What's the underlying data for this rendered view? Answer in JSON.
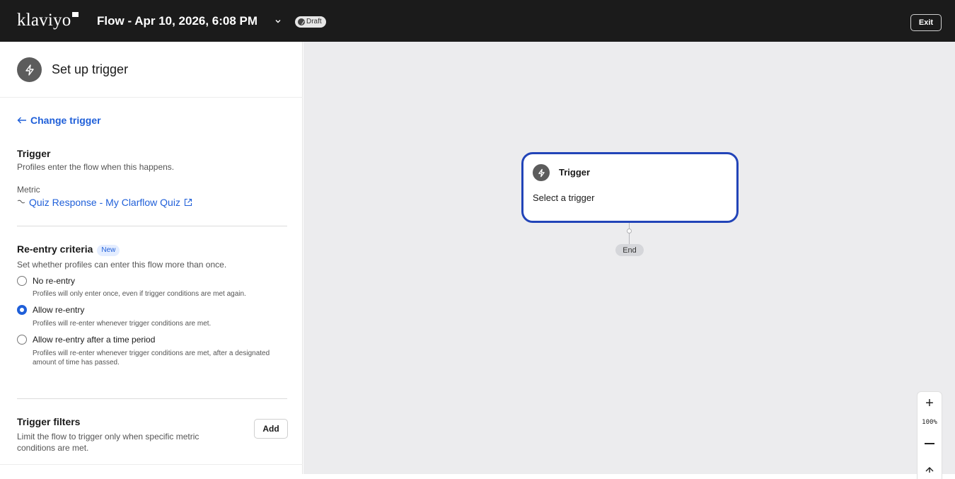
{
  "header": {
    "logo": "klaviyo",
    "flow_title": "Flow - Apr 10, 2026, 6:08 PM",
    "status_badge": "Draft",
    "exit_label": "Exit"
  },
  "sidebar": {
    "title": "Set up trigger",
    "change_trigger": "Change trigger",
    "trigger": {
      "title": "Trigger",
      "description": "Profiles enter the flow when this happens.",
      "metric_label": "Metric",
      "metric_value": "Quiz Response - My Clarflow Quiz"
    },
    "reentry": {
      "title": "Re-entry criteria",
      "badge": "New",
      "description": "Set whether profiles can enter this flow more than once.",
      "options": [
        {
          "label": "No re-entry",
          "description": "Profiles will only enter once, even if trigger conditions are met again.",
          "selected": false
        },
        {
          "label": "Allow re-entry",
          "description": "Profiles will re-enter whenever trigger conditions are met.",
          "selected": true
        },
        {
          "label": "Allow re-entry after a time period",
          "description": "Profiles will re-enter whenever trigger conditions are met, after a designated amount of time has passed.",
          "selected": false
        }
      ]
    },
    "filters": {
      "title": "Trigger filters",
      "description": "Limit the flow to trigger only when specific metric conditions are met.",
      "add_label": "Add"
    }
  },
  "canvas": {
    "trigger_card": {
      "title": "Trigger",
      "subtitle": "Select a trigger"
    },
    "end_label": "End",
    "zoom": {
      "plus": "+",
      "level": "100%"
    }
  },
  "colors": {
    "topbar": "#1b1b1b",
    "link": "#1f5fd9",
    "card_border": "#2244b8",
    "canvas": "#ececee"
  }
}
